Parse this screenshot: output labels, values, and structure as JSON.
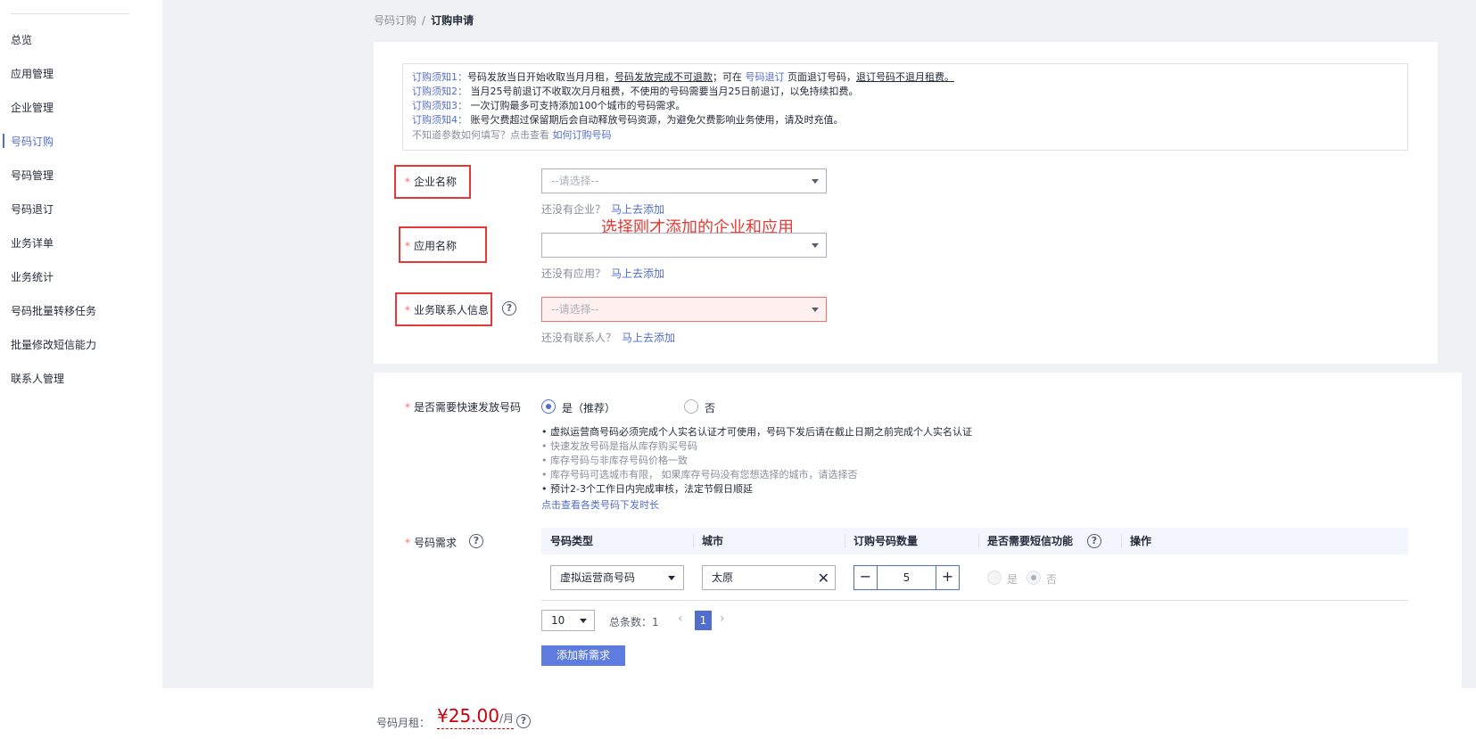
{
  "sidebar": {
    "items": [
      {
        "label": "总览"
      },
      {
        "label": "应用管理"
      },
      {
        "label": "企业管理"
      },
      {
        "label": "号码订购"
      },
      {
        "label": "号码管理"
      },
      {
        "label": "号码退订"
      },
      {
        "label": "业务详单"
      },
      {
        "label": "业务统计"
      },
      {
        "label": "号码批量转移任务"
      },
      {
        "label": "批量修改短信能力"
      },
      {
        "label": "联系人管理"
      }
    ],
    "active": "号码订购"
  },
  "breadcrumb": {
    "parent": "号码订购",
    "separator": "/",
    "current": "订购申请"
  },
  "notices": {
    "n1": {
      "label": "订购须知1：",
      "part1": "号码发放当日开始收取当月月租，",
      "part2": "号码发放完成不可退款",
      "part3": "；可在 ",
      "link": "号码退订",
      "part4": " 页面退订号码，",
      "part5": "退订号码不退月租费。"
    },
    "n2": {
      "label": "订购须知2：",
      "text": " 当月25号前退订不收取次月月租费，不使用的号码需要当月25日前退订，以免持续扣费。"
    },
    "n3": {
      "label": "订购须知3：",
      "text": " 一次订购最多可支持添加100个城市的号码需求。"
    },
    "n4": {
      "label": "订购须知4：",
      "text": " 账号欠费超过保留期后会自动释放号码资源，为避免欠费影响业务使用，请及时充值。"
    },
    "help": {
      "text": "不知道参数如何填写？点击查看 ",
      "link": "如何订购号码"
    }
  },
  "form": {
    "required_mark": "*",
    "enterprise": {
      "label": "企业名称",
      "placeholder": "--请选择--",
      "hint": "还没有企业？",
      "hint_link": "马上去添加"
    },
    "app": {
      "label": "应用名称",
      "value": "",
      "hint": "还没有应用？",
      "hint_link": "马上去添加"
    },
    "contact": {
      "label": "业务联系人信息",
      "placeholder": "--请选择--",
      "hint": "还没有联系人？",
      "hint_link": "马上去添加"
    }
  },
  "annotation": {
    "text": "选择刚才添加的企业和应用",
    "color": "#e53935"
  },
  "fast_issue": {
    "label": "是否需要快速发放号码",
    "option_yes": "是（推荐）",
    "option_no": "否",
    "selected": "yes",
    "bullets": [
      {
        "text": "• 虚拟运营商号码必须完成个人实名认证才可使用，号码下发后请在截止日期之前完成个人实名认证",
        "style": "dark"
      },
      {
        "text": "• 快速发放号码是指从库存购买号码",
        "style": "gray"
      },
      {
        "text": "• 库存号码与非库存号码价格一致",
        "style": "gray"
      },
      {
        "text": "• 库存号码可选城市有限， 如果库存号码没有您想选择的城市，请选择否",
        "style": "gray"
      },
      {
        "text": "• 预计2-3个工作日内完成审核，法定节假日顺延",
        "style": "dark"
      }
    ],
    "link": "点击查看各类号码下发时长"
  },
  "demand": {
    "label": "号码需求",
    "columns": [
      "号码类型",
      "城市",
      "订购号码数量",
      "是否需要短信功能",
      "操作"
    ],
    "rows": [
      {
        "type": "虚拟运营商号码",
        "city": "太原",
        "quantity": "5",
        "sms_yes": "是",
        "sms_no": "否",
        "sms_selected": "no"
      }
    ]
  },
  "pager": {
    "page_size": "10",
    "total": "总条数：1",
    "prev": "‹",
    "next": "›",
    "current_page": "1"
  },
  "add_button": "添加新需求",
  "price": {
    "label": "号码月租：",
    "amount": "¥25.00",
    "unit": "/月"
  },
  "colors": {
    "accent": "#526ecc",
    "required": "#f66f6a",
    "annotation_box": "#e53935",
    "price": "#c7000b"
  }
}
